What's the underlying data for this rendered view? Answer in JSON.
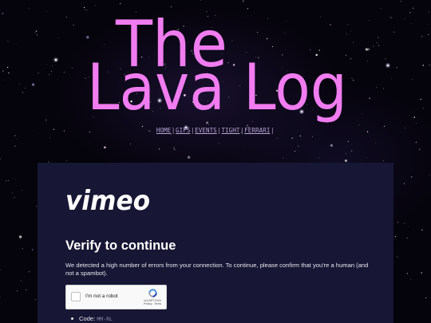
{
  "site": {
    "title_line1": "The",
    "title_line2": "Lava Log",
    "title_color": "#f07cf0",
    "background": "starfield"
  },
  "nav": {
    "items": [
      {
        "label": "HOME"
      },
      {
        "label": "GIFS"
      },
      {
        "label": "EVENTS"
      },
      {
        "label": "TIGHT"
      },
      {
        "label": "FERRARI"
      }
    ],
    "separator": "|"
  },
  "panel": {
    "background": "#171634",
    "logo": "vimeo",
    "heading": "Verify to continue",
    "message": "We detected a high number of errors from your connection. To continue, please confirm that you're a human (and not a spambot).",
    "captcha": {
      "checkbox_label": "I'm not a robot",
      "brand": "reCAPTCHA",
      "links": "Privacy - Terms",
      "checked": false
    },
    "details": [
      {
        "label": "Code:",
        "value": "MM-RL"
      }
    ]
  }
}
